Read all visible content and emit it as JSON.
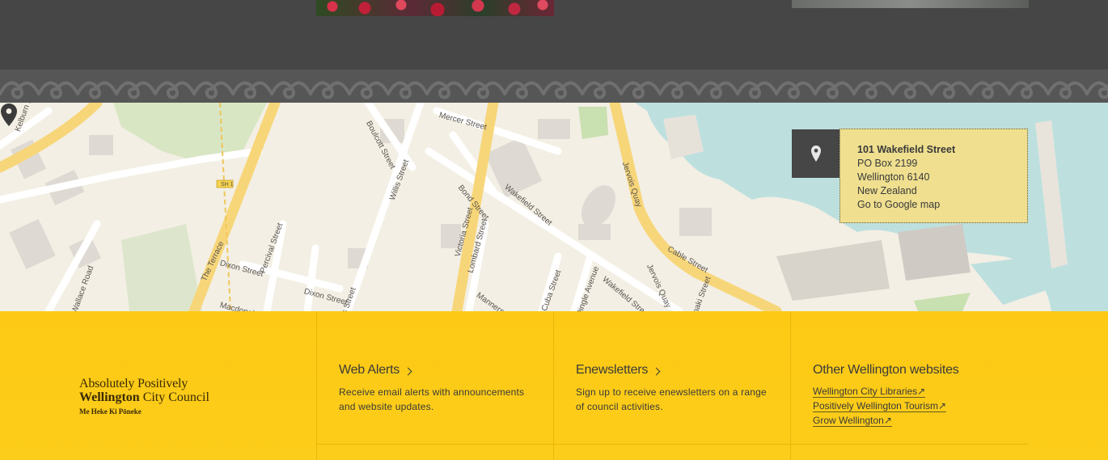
{
  "address": {
    "street": "101 Wakefield Street",
    "po_box": "PO Box 2199",
    "city": "Wellington 6140",
    "country": "New Zealand",
    "map_link": "Go to Google map"
  },
  "map": {
    "street_labels": [
      "Kelburn Pa",
      "Mercer Street",
      "Boulcott Street",
      "Willis Street",
      "Bond Street",
      "Wakefield Street",
      "Jervois Quay",
      "SH 1",
      "The Terrace",
      "Percival Street",
      "Dixon Street",
      "Victoria Street",
      "Lombard Street",
      "Cable Street",
      "Wallace Road",
      "Dixon Street",
      "Macdonald",
      "is Street",
      "Manners S",
      "Cuba Street",
      "Dingle Avenue",
      "Wakefield Street",
      "Jervois Quay",
      "naki Street"
    ]
  },
  "footer": {
    "logo": {
      "line1": "Absolutely Positively",
      "line2_bold": "Wellington",
      "line2_rest": " City Council",
      "line3": "Me Heke Ki Pōneke"
    },
    "web_alerts": {
      "title": "Web Alerts",
      "text": "Receive email alerts with announcements and website updates."
    },
    "enewsletters": {
      "title": "Enewsletters",
      "text": "Sign up to receive enewsletters on a range of council activities."
    },
    "other_sites": {
      "title": "Other Wellington websites",
      "links": [
        "Wellington City Libraries",
        "Positively Wellington Tourism",
        "Grow Wellington"
      ]
    }
  }
}
